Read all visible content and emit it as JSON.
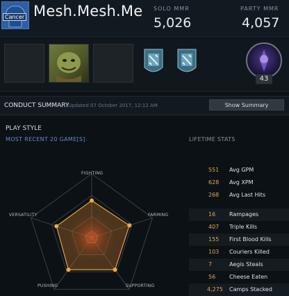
{
  "profile": {
    "name": "Mesh.Mesh.Me",
    "avatar_label": "Cancer"
  },
  "mmr": {
    "solo_label": "SOLO MMR",
    "solo_value": "5,026",
    "party_label": "PARTY MMR",
    "party_value": "4,057"
  },
  "hero_strip": {
    "level": "43"
  },
  "conduct": {
    "title": "CONDUCT SUMMARY",
    "updated": "Updated 07 October 2017, 12:12 AM",
    "button": "Show Summary"
  },
  "play_style": {
    "title": "PLAY STYLE",
    "recent_label": "MOST RECENT 20 GAME[S]",
    "lifetime_label": "LIFETIME STATS",
    "axes": [
      "FIGHTING",
      "FARMING",
      "SUPPORTING",
      "PUSHING",
      "VERSATILITY"
    ],
    "values": [
      0.58,
      0.62,
      0.62,
      0.62,
      0.58
    ]
  },
  "lifetime_stats": [
    {
      "value": "551",
      "label": "Avg GPM"
    },
    {
      "value": "628",
      "label": "Avg XPM"
    },
    {
      "value": "268",
      "label": "Avg Last Hits"
    },
    {
      "value": "16",
      "label": "Rampages"
    },
    {
      "value": "407",
      "label": "Triple Kills"
    },
    {
      "value": "155",
      "label": "First Blood Kills"
    },
    {
      "value": "103",
      "label": "Couriers Killed"
    },
    {
      "value": "7",
      "label": "Aegis Steals"
    },
    {
      "value": "56",
      "label": "Cheese Eaten"
    },
    {
      "value": "4,275",
      "label": "Camps Stacked"
    }
  ],
  "colors": {
    "accent": "#e0a84a",
    "radar_fill": "#c9782a",
    "blue_text": "#5d8fbf"
  }
}
